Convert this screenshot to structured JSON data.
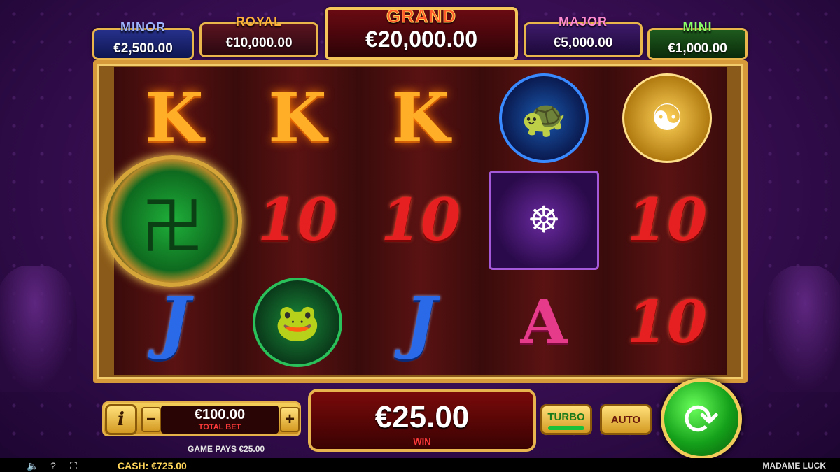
{
  "jackpots": {
    "minor": {
      "name": "MINOR",
      "value": "€2,500.00"
    },
    "royal": {
      "name": "ROYAL",
      "value": "€10,000.00"
    },
    "grand": {
      "name": "GRAND",
      "value": "€20,000.00"
    },
    "major": {
      "name": "MAJOR",
      "value": "€5,000.00"
    },
    "mini": {
      "name": "MINI",
      "value": "€1,000.00"
    }
  },
  "reels": [
    [
      "K",
      "jade-coin",
      "J"
    ],
    [
      "K",
      "10",
      "toad"
    ],
    [
      "K",
      "10",
      "J"
    ],
    [
      "dragon-turtle",
      "buddha",
      "A"
    ],
    [
      "lucky-coins",
      "10",
      "10"
    ]
  ],
  "bet": {
    "value": "€100.00",
    "label": "TOTAL BET",
    "minus": "−",
    "plus": "+",
    "info": "i"
  },
  "win": {
    "value": "€25.00",
    "label": "WIN"
  },
  "buttons": {
    "turbo": "TURBO",
    "auto": "AUTO"
  },
  "game_pays": "GAME PAYS €25.00",
  "footer": {
    "cash": "CASH:  €725.00",
    "brand": "MADAME LUCK"
  },
  "colors": {
    "gold": "#e8b64a",
    "panel_red": "#3a0202",
    "spin_green": "#14a01a"
  }
}
